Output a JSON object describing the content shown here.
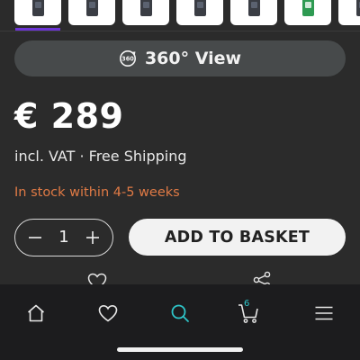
{
  "gallery": {
    "thumbnails": [
      {
        "name": "device-front-view"
      },
      {
        "name": "device-screen-view"
      },
      {
        "name": "device-angle-view"
      },
      {
        "name": "device-side-view"
      },
      {
        "name": "device-detail-view"
      },
      {
        "name": "device-green-case-view"
      },
      {
        "name": "device-accessory-view"
      }
    ],
    "selected_index": 0
  },
  "view360": {
    "label": "360° View",
    "icon": "rotate-360-icon",
    "icon_text": "360"
  },
  "product": {
    "price": "€ 289",
    "price_note": "incl. VAT · Free Shipping",
    "stock_status": "In stock within 4-5 weeks"
  },
  "purchase": {
    "quantity": "1",
    "add_to_basket_label": "ADD TO BASKET"
  },
  "actions": {
    "wishlist_icon": "heart-outline-icon",
    "share_icon": "share-icon"
  },
  "bottom_nav": {
    "items": [
      {
        "icon": "home-icon"
      },
      {
        "icon": "heart-icon"
      },
      {
        "icon": "search-icon",
        "active": true
      },
      {
        "icon": "cart-icon",
        "badge": "6"
      },
      {
        "icon": "menu-icon"
      }
    ]
  },
  "colors": {
    "background": "#2b2b2b",
    "stock_text": "#e07a45",
    "accent_active": "#2ec4c8",
    "selected_thumbnail": "#6d35d6",
    "primary_button": "#f2f2f2"
  }
}
